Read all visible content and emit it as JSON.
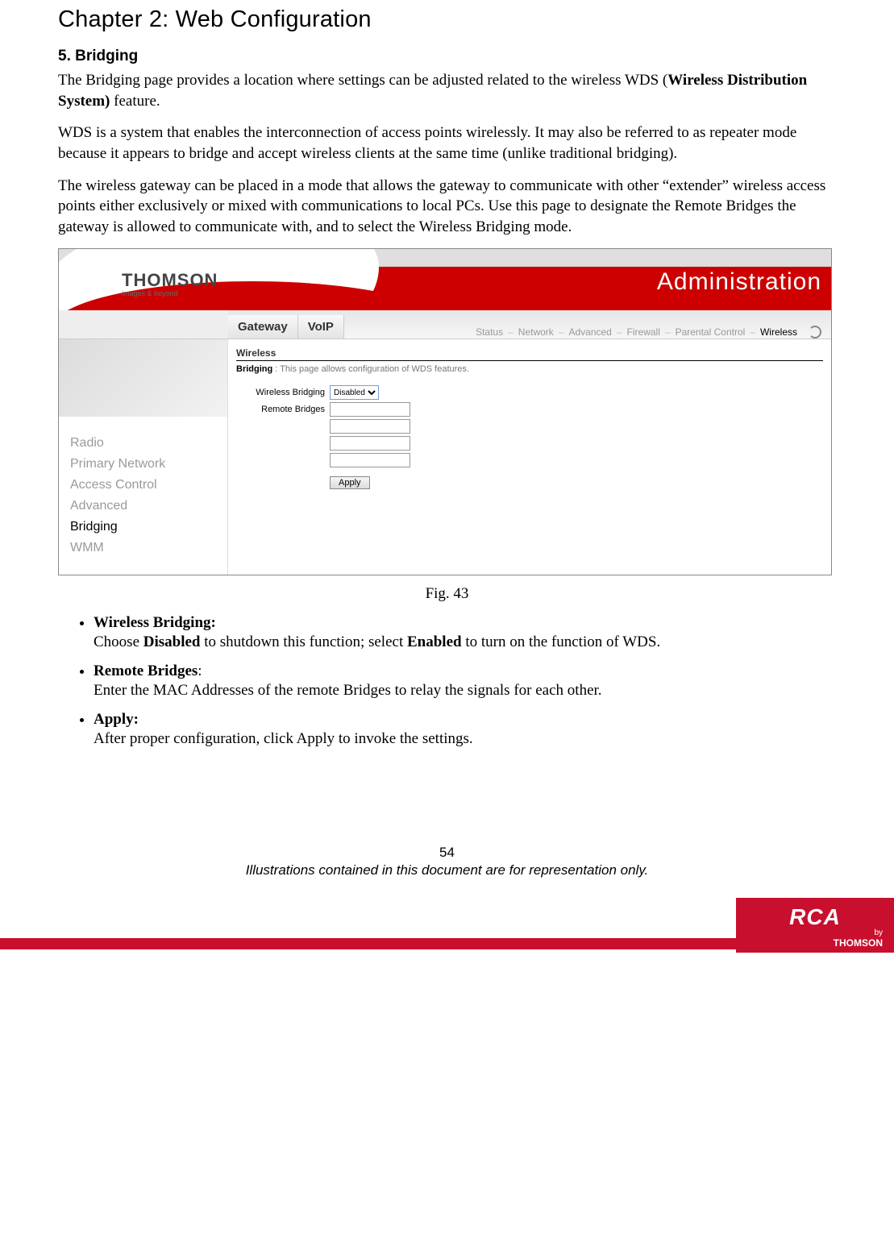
{
  "chapter": "Chapter 2: Web Configuration",
  "section": "5. Bridging",
  "para1_prefix": "The Bridging page provides a location where settings can be adjusted related to the wireless WDS (",
  "para1_bold": "Wireless Distribution System)",
  "para1_suffix": " feature.",
  "para2": "WDS is a system that enables the interconnection of access points wirelessly. It may also be referred to as repeater mode because it appears to bridge and accept wireless clients at the same time (unlike traditional bridging).",
  "para3": "The wireless gateway can be placed in a mode that allows the gateway to communicate with other “extender” wireless access points either exclusively or mixed with communications to local PCs. Use this page to designate the Remote Bridges the gateway is allowed to communicate with, and to select the Wireless Bridging mode.",
  "ui": {
    "brand": "THOMSON",
    "brand_sub": "images & beyond",
    "banner_right": "Administration",
    "tab_gateway": "Gateway",
    "tab_voip": "VoIP",
    "crumbs": {
      "status": "Status",
      "network": "Network",
      "advanced": "Advanced",
      "firewall": "Firewall",
      "parental": "Parental Control",
      "wireless": "Wireless"
    },
    "sidebar": {
      "radio": "Radio",
      "primary": "Primary Network",
      "access": "Access Control",
      "advanced": "Advanced",
      "bridging": "Bridging",
      "wmm": "WMM"
    },
    "panel_title": "Wireless",
    "panel_label": "Bridging",
    "panel_desc": "This page allows configuration of WDS features.",
    "form": {
      "wb_label": "Wireless Bridging",
      "wb_value": "Disabled",
      "rb_label": "Remote Bridges",
      "apply": "Apply"
    }
  },
  "fig": "Fig. 43",
  "bullets": {
    "b1h": "Wireless Bridging:",
    "b1a": "Choose ",
    "b1b": "Disabled",
    "b1c": " to shutdown this function; select ",
    "b1d": "Enabled",
    "b1e": " to turn on the function of WDS.",
    "b2h": "Remote Bridges",
    "b2colon": ":",
    "b2d": "Enter the MAC Addresses of the remote Bridges to relay the signals for each other.",
    "b3h": "Apply:",
    "b3d": "After proper configuration, click Apply to invoke the settings."
  },
  "footer": {
    "page": "54",
    "note": "Illustrations contained in this document are for representation only."
  },
  "logo": {
    "rca": "RCA",
    "by": "by",
    "thomson": "THOMSON"
  }
}
